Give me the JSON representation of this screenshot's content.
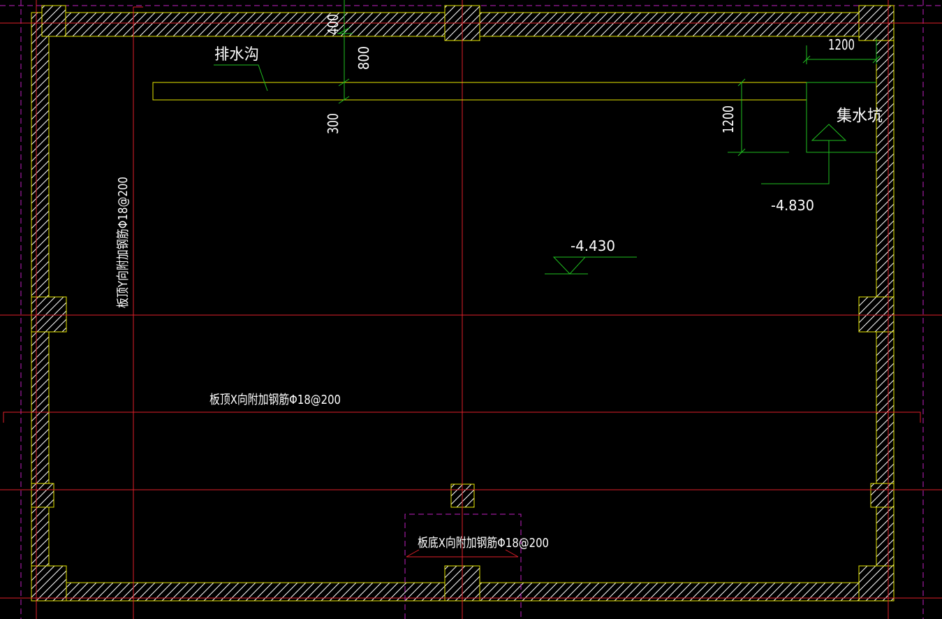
{
  "colors": {
    "background": "#000000",
    "axis_line": "#e0202a",
    "wall_outline": "#e6e600",
    "dimension": "#20c020",
    "viewport_border": "#c020c0",
    "text": "#ffffff"
  },
  "labels": {
    "drain_ditch": "排水沟",
    "sump_pit": "集水坑",
    "rebar_top_y": "板顶Y向附加钢筋Φ18@200",
    "rebar_top_x": "板顶X向附加钢筋Φ18@200",
    "rebar_bottom_x": "板底X向附加钢筋Φ18@200"
  },
  "dimensions": {
    "top_offset": "400",
    "ditch_to_wall": "800",
    "ditch_width": "300",
    "pit_width": "1200",
    "pit_depth": "1200"
  },
  "elevations": {
    "slab": "-4.430",
    "pit_bottom": "-4.830"
  }
}
